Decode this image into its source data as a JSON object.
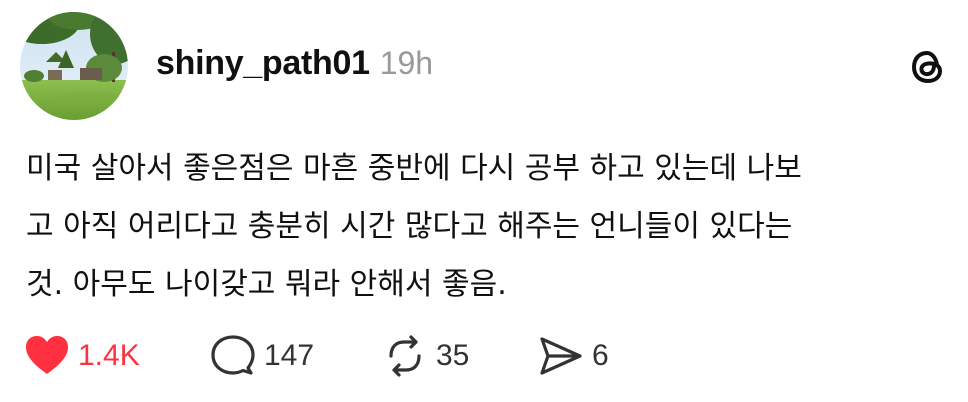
{
  "post": {
    "username": "shiny_path01",
    "timestamp": "19h",
    "body_lines": [
      "미국 살아서 좋은점은 마흔 중반에 다시 공부 하고 있는데 나보",
      "고 아직 어리다고 충분히 시간 많다고 해주는 언니들이 있다는",
      "것. 아무도 나이갖고 뭐라 안해서 좋음."
    ]
  },
  "actions": {
    "like_count": "1.4K",
    "reply_count": "147",
    "repost_count": "35",
    "share_count": "6"
  },
  "colors": {
    "like_accent": "#ff3040",
    "timestamp": "#999999",
    "text": "#101010"
  },
  "icons": [
    "avatar-photo",
    "threads-logo-icon",
    "heart-icon",
    "comment-icon",
    "repost-icon",
    "share-icon"
  ]
}
